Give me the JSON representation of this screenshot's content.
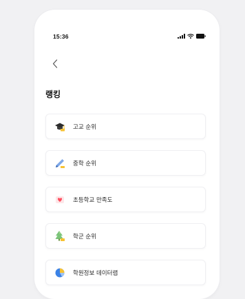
{
  "status_bar": {
    "time": "15:36",
    "icons": [
      "signal-icon",
      "wifi-icon",
      "battery-icon"
    ]
  },
  "nav": {
    "back_icon": "chevron-left-icon",
    "back_glyph": "<"
  },
  "page": {
    "title": "랭킹"
  },
  "ranking_items": [
    {
      "label": "고교 순위",
      "icon": "graduation-cap-icon"
    },
    {
      "label": "중학 순위",
      "icon": "pencil-icon"
    },
    {
      "label": "초등학교 만족도",
      "icon": "heart-icon"
    },
    {
      "label": "학군 순위",
      "icon": "tree-icon"
    },
    {
      "label": "학원정보 데이터랩",
      "icon": "pie-chart-icon"
    }
  ],
  "colors": {
    "background": "#f1f1f3",
    "card_border": "#efeff2",
    "text": "#2b2b2b",
    "heart": "#ff4d5e"
  }
}
